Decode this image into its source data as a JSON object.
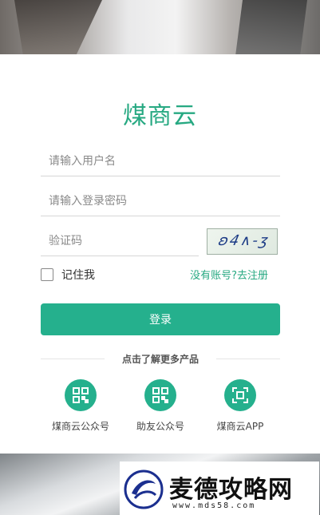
{
  "app": {
    "title": "煤商云"
  },
  "form": {
    "username_placeholder": "请输入用户名",
    "password_placeholder": "请输入登录密码",
    "captcha_placeholder": "验证码",
    "captcha_text": "ʚ4∧-ʒ",
    "remember_label": "记住我",
    "register_link": "没有账号?去注册",
    "login_button": "登录"
  },
  "more": {
    "label": "点击了解更多产品",
    "items": [
      {
        "label": "煤商云公众号",
        "icon": "qr-code-icon"
      },
      {
        "label": "助友公众号",
        "icon": "qr-code-icon"
      },
      {
        "label": "煤商云APP",
        "icon": "scan-icon"
      }
    ]
  },
  "watermark": {
    "text": "麦德攻略网",
    "url": "www.mds58.com"
  },
  "colors": {
    "accent": "#25b08d",
    "title": "#27a982"
  }
}
